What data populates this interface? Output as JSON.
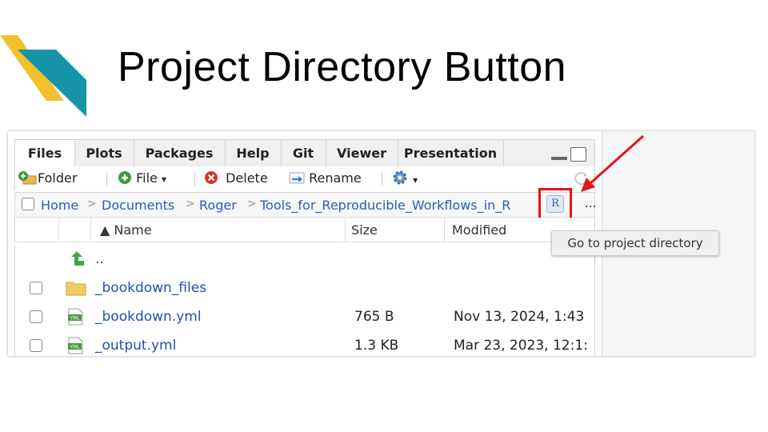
{
  "slide": {
    "title": "Project Directory Button"
  },
  "tabs": [
    {
      "label": "Files"
    },
    {
      "label": "Plots"
    },
    {
      "label": "Packages"
    },
    {
      "label": "Help"
    },
    {
      "label": "Git"
    },
    {
      "label": "Viewer"
    },
    {
      "label": "Presentation"
    }
  ],
  "toolbar": {
    "folder_label": "Folder",
    "file_label": "File",
    "delete_label": "Delete",
    "rename_label": "Rename",
    "dropdown_glyph": "▾"
  },
  "path": {
    "crumbs": [
      "Home",
      "Documents",
      "Roger",
      "Tools_for_Reproducible_Workflows_in_R"
    ],
    "separator": ">",
    "project_button_glyph": "R",
    "more_label": "..."
  },
  "columns": {
    "name": "▲ Name",
    "size": "Size",
    "modified": "Modified"
  },
  "rows": [
    {
      "name": "..",
      "size": "",
      "modified": ""
    },
    {
      "name": "_bookdown_files",
      "size": "",
      "modified": ""
    },
    {
      "name": "_bookdown.yml",
      "size": "765 B",
      "modified": "Nov 13, 2024, 1:43"
    },
    {
      "name": "_output.yml",
      "size": "1.3 KB",
      "modified": "Mar 23, 2023, 12:1:"
    }
  ],
  "tooltip": {
    "text": "Go to project directory"
  },
  "colors": {
    "accent_red": "#e3141a",
    "link_blue": "#1f4fb3",
    "deco_yellow": "#f0c02e",
    "deco_teal": "#1795a8"
  }
}
